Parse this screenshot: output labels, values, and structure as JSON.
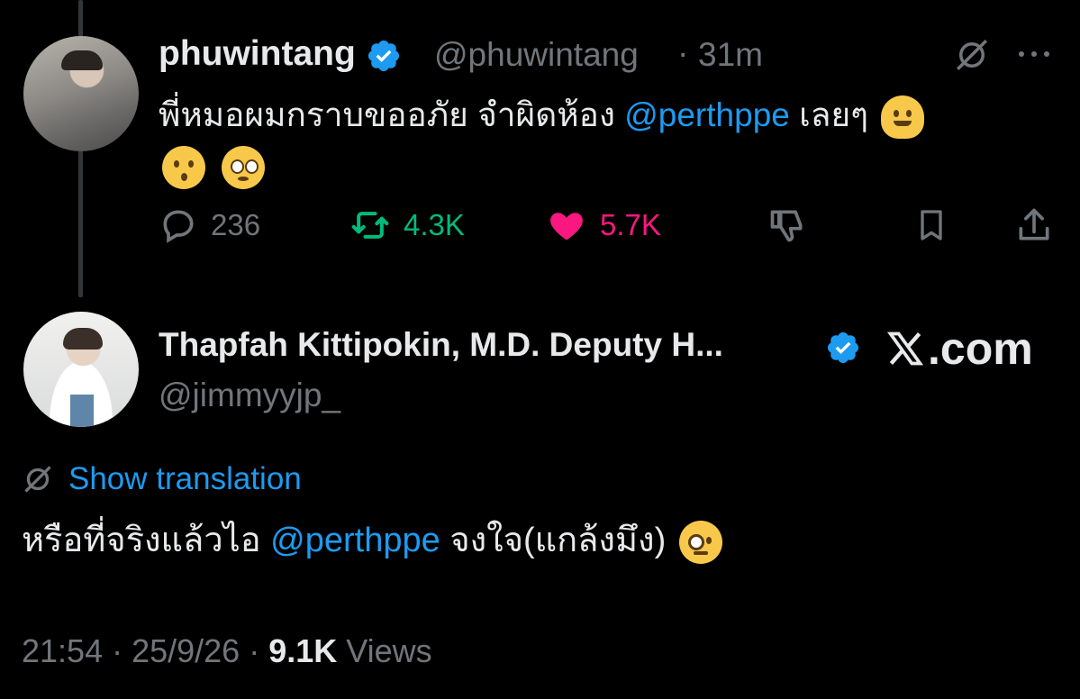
{
  "reply_tweet": {
    "display_name": "phuwintang",
    "handle": "@phuwintang",
    "separator": "·",
    "time": "31m",
    "text_before": "พี่หมอผมกราบขออภัย จำผิดห้อง ",
    "mention": "@perthppe",
    "text_after": " เลยๆ",
    "emojis": [
      "melting-face",
      "kissing-face",
      "face-holding-back-tears"
    ],
    "actions": {
      "replies": "236",
      "reposts": "4.3K",
      "likes": "5.7K"
    }
  },
  "quoted_tweet": {
    "display_name": "Thapfah Kittipokin, M.D. Deputy H...",
    "handle": "@jimmyyjp_",
    "watermark": ".com",
    "show_translation": "Show translation",
    "text_before": "หรือที่จริงแล้วไอ ",
    "mention": "@perthppe",
    "text_after": " จงใจ(แกล้งมึง)",
    "emoji": "face-with-monocle",
    "timestamp": "21:54 · 25/9/26 · ",
    "views_count": "9.1K",
    "views_label": " Views"
  },
  "colors": {
    "background": "#000000",
    "text": "#e7e9ea",
    "muted": "#71767b",
    "link": "#1d9bf0",
    "repost": "#00ba7c",
    "like": "#f91880"
  }
}
